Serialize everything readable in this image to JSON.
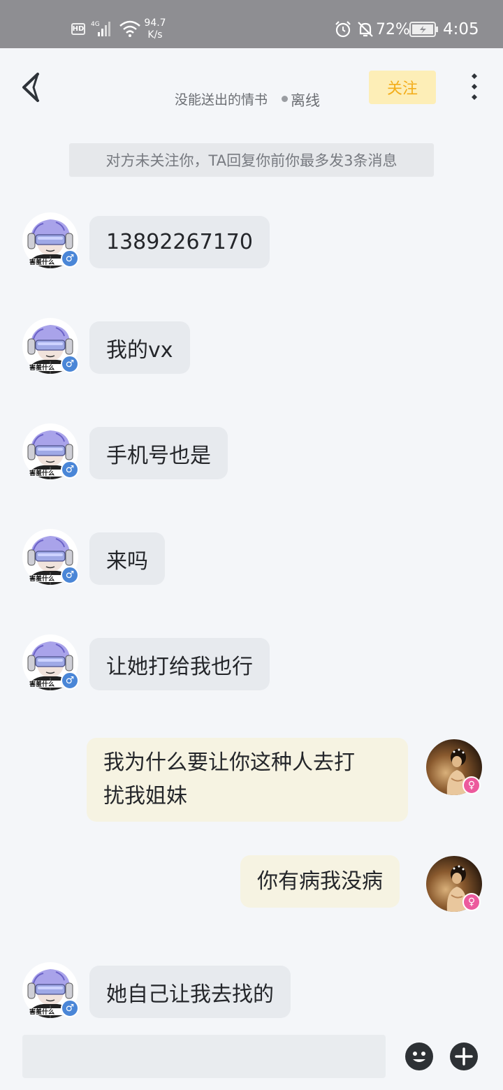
{
  "status_bar": {
    "hd": "HD",
    "network": "4G",
    "speed_value": "94.7",
    "speed_unit": "K/s",
    "battery_percent": "72%",
    "time": "4:05"
  },
  "header": {
    "contact_name": "没能送出的情书",
    "status": "离线",
    "follow_label": "关注"
  },
  "notice": "对方未关注你，TA回复你前你最多发3条消息",
  "messages": [
    {
      "side": "in",
      "text": "13892267170"
    },
    {
      "side": "in",
      "text": "我的vx"
    },
    {
      "side": "in",
      "text": "手机号也是"
    },
    {
      "side": "in",
      "text": "来吗"
    },
    {
      "side": "in",
      "text": "让她打给我也行"
    },
    {
      "side": "out",
      "text_line1": "我为什么要让你这种人去打",
      "text_line2": "扰我姐妹"
    },
    {
      "side": "out",
      "text": "你有病我没病"
    },
    {
      "side": "in",
      "text": "她自己让我去找的"
    }
  ],
  "avatar_caption": "害羞什么",
  "gender": {
    "male": "♂",
    "female": "♀"
  },
  "input": {
    "placeholder": ""
  },
  "icons": {
    "back": "chevron-left-icon",
    "more": "vertical-dots-icon",
    "emoji": "smiley-icon",
    "plus": "plus-icon"
  },
  "colors": {
    "status_bar": "#8e8e92",
    "background": "#f4f6f9",
    "bubble_in": "#e7eaee",
    "bubble_out": "#f6f3e2",
    "follow_bg": "#fdeeb7",
    "follow_text": "#f3ad1a",
    "male_badge": "#4a86d7",
    "female_badge": "#ec5a9d"
  }
}
